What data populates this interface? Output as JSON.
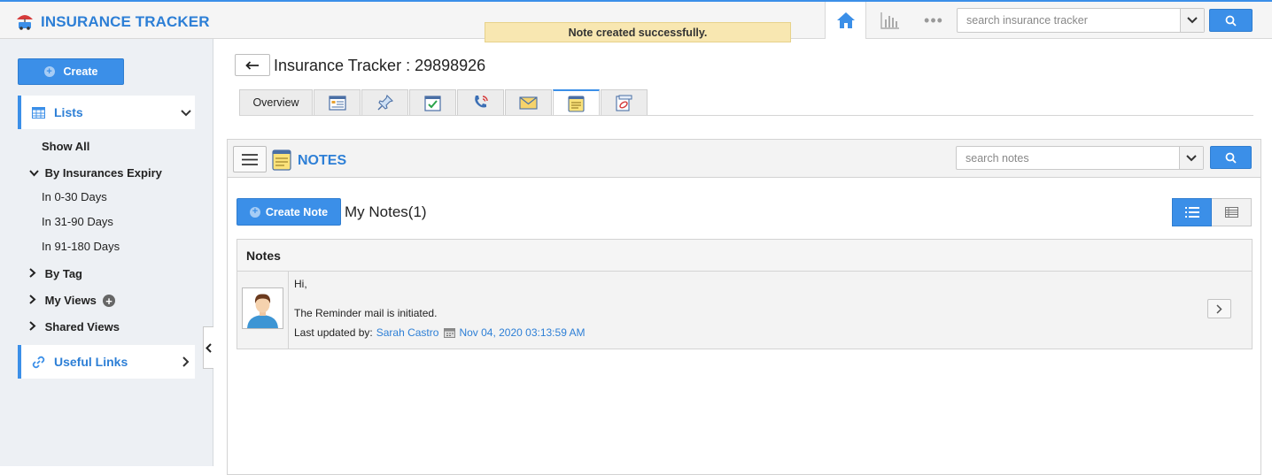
{
  "app": {
    "title": "INSURANCE TRACKER"
  },
  "topbar": {
    "search_placeholder": "search insurance tracker",
    "icons": [
      "home-icon",
      "bar-chart-icon",
      "more-dots-icon",
      "search-icon"
    ],
    "more_label": "•••"
  },
  "toast": {
    "message": "Note created successfully."
  },
  "sidebar": {
    "create_label": "Create",
    "lists_label": "Lists",
    "show_all": "Show All",
    "expiry_group": "By Insurances Expiry",
    "expiry_items": [
      "In 0-30 Days",
      "In 31-90 Days",
      "In 91-180 Days"
    ],
    "by_tag": "By Tag",
    "my_views": "My Views",
    "shared_views": "Shared Views",
    "useful_links": "Useful Links"
  },
  "page": {
    "title": "Insurance Tracker : 29898926",
    "tabs": [
      {
        "label": "Overview"
      },
      {
        "icon": "details-icon"
      },
      {
        "icon": "pin-icon"
      },
      {
        "icon": "tasks-icon"
      },
      {
        "icon": "calls-icon"
      },
      {
        "icon": "email-icon"
      },
      {
        "icon": "notes-icon",
        "active": true
      },
      {
        "icon": "attachments-icon"
      }
    ]
  },
  "notes": {
    "section_title": "NOTES",
    "search_placeholder": "search notes",
    "create_label": "Create Note",
    "heading": "My Notes(1)",
    "column_header": "Notes",
    "items": [
      {
        "line1": "Hi,",
        "line2": "The Reminder mail is initiated.",
        "updated_by_label": "Last updated by:",
        "updated_by": "Sarah Castro",
        "timestamp": "Nov 04, 2020 03:13:59 AM"
      }
    ]
  },
  "colors": {
    "accent": "#3b8fe8",
    "brand": "#2d7fd6",
    "toast": "#f8e7b1"
  }
}
